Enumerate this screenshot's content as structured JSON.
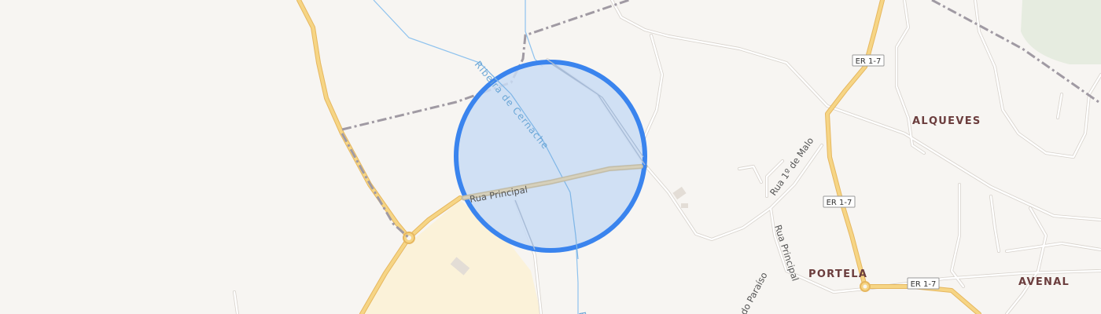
{
  "map": {
    "colors": {
      "background": "#f7f5f2",
      "major_road": "#f6d585",
      "major_road_casing": "#e6b75f",
      "minor_road": "#ffffff",
      "minor_road_casing": "#d7d2cc",
      "boundary": "#a09aa3",
      "water": "#8ec2ee",
      "circle_fill": "#c9dcf4",
      "circle_stroke": "#3a84ee",
      "landuse_yellow": "#fbf2d9",
      "landuse_green": "#e6ece0"
    },
    "places": {
      "alqueves": "ALQUEVES",
      "portela": "PORTELA",
      "avenal": "AVENAL"
    },
    "roads": {
      "rua_principal_a": "Rua Principal",
      "rua_principal_b": "Rua Principal",
      "rua_1_de_maio": "Rua 1º de Malo",
      "rua_paraiso": "do Paraíso"
    },
    "water": {
      "stream": "Ribeira de Cernache",
      "stream_bottom": "Ri"
    },
    "shields": {
      "er_top": "ER 1-7",
      "er_mid": "ER 1-7",
      "er_bottom": "ER 1-7"
    },
    "selection": {
      "shape": "circle",
      "icon": "selection-circle"
    }
  }
}
